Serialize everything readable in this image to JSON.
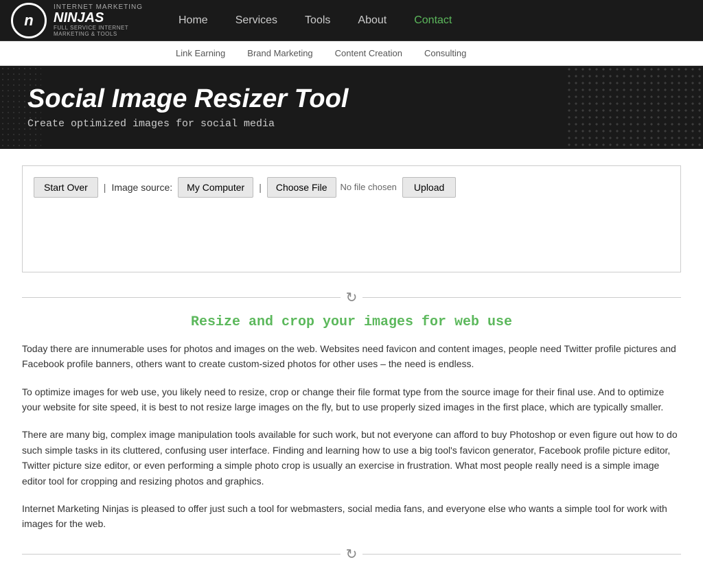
{
  "nav": {
    "logo": {
      "line1": "INTERNET MARKETING",
      "line2": "NINJAS",
      "line3": "FULL SERVICE INTERNET MARKETING & TOOLS"
    },
    "items": [
      {
        "label": "Home",
        "active": false
      },
      {
        "label": "Services",
        "active": false
      },
      {
        "label": "Tools",
        "active": false
      },
      {
        "label": "About",
        "active": false
      },
      {
        "label": "Contact",
        "active": true
      }
    ],
    "sub_items": [
      {
        "label": "Link Earning"
      },
      {
        "label": "Brand Marketing"
      },
      {
        "label": "Content Creation"
      },
      {
        "label": "Consulting"
      }
    ]
  },
  "hero": {
    "title": "Social Image Resizer Tool",
    "subtitle": "Create optimized images for social media"
  },
  "tool": {
    "start_over": "Start Over",
    "image_source_label": "Image source:",
    "my_computer": "My Computer",
    "choose_file": "Choose File",
    "no_file": "No file chosen",
    "upload": "Upload"
  },
  "divider_icon": "↻",
  "section_heading": "Resize and crop your images for web use",
  "paragraphs": [
    "Today there are innumerable uses for photos and images on the web. Websites need favicon and content images, people need Twitter profile pictures and Facebook profile banners, others want to create custom-sized photos for other uses – the need is endless.",
    "To optimize images for web use, you likely need to resize, crop or change their file format type from the source image for their final use. And to optimize your website for site speed, it is best to not resize large images on the fly, but to use properly sized images in the first place, which are typically smaller.",
    "There are many big, complex image manipulation tools available for such work, but not everyone can afford to buy Photoshop or even figure out how to do such simple tasks in its cluttered, confusing user interface. Finding and learning how to use a big tool's favicon generator, Facebook profile picture editor, Twitter picture size editor, or even performing a simple photo crop is usually an exercise in frustration. What most people really need is a simple image editor tool for cropping and resizing photos and graphics.",
    "Internet Marketing Ninjas is pleased to offer just such a tool for webmasters, social media fans, and everyone else who wants a simple tool for work with images for the web."
  ],
  "bottom_divider_icon": "↻"
}
